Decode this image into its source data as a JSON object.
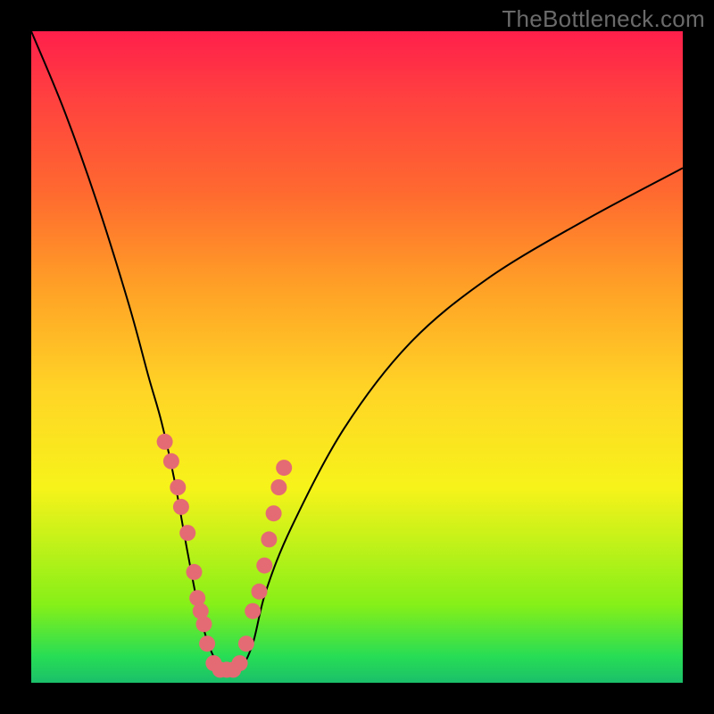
{
  "watermark": "TheBottleneck.com",
  "chart_data": {
    "type": "line",
    "title": "",
    "xlabel": "",
    "ylabel": "",
    "xlim": [
      0,
      100
    ],
    "ylim": [
      0,
      100
    ],
    "background_gradient": {
      "top": "#ff1f4b",
      "mid": "#ffd426",
      "bottom": "#1bbf6a"
    },
    "series": [
      {
        "name": "bottleneck-curve",
        "x": [
          0,
          5,
          10,
          15,
          18,
          20,
          22,
          24,
          26,
          28,
          30,
          32,
          34,
          36,
          40,
          48,
          58,
          70,
          85,
          100
        ],
        "values": [
          100,
          88,
          74,
          58,
          47,
          40,
          31,
          20,
          10,
          4,
          2,
          2,
          6,
          14,
          24,
          39,
          52,
          62,
          71,
          79
        ]
      }
    ],
    "scatter": {
      "name": "highlighted-points",
      "x": [
        20.5,
        21.5,
        22.5,
        23.0,
        24.0,
        25.0,
        25.5,
        26.0,
        26.5,
        27.0,
        28.0,
        29.0,
        30.0,
        31.0,
        32.0,
        33.0,
        34.0,
        35.0,
        35.8,
        36.5,
        37.2,
        38.0,
        38.8
      ],
      "values": [
        37,
        34,
        30,
        27,
        23,
        17,
        13,
        11,
        9,
        6,
        3,
        2,
        2,
        2,
        3,
        6,
        11,
        14,
        18,
        22,
        26,
        30,
        33
      ]
    }
  }
}
